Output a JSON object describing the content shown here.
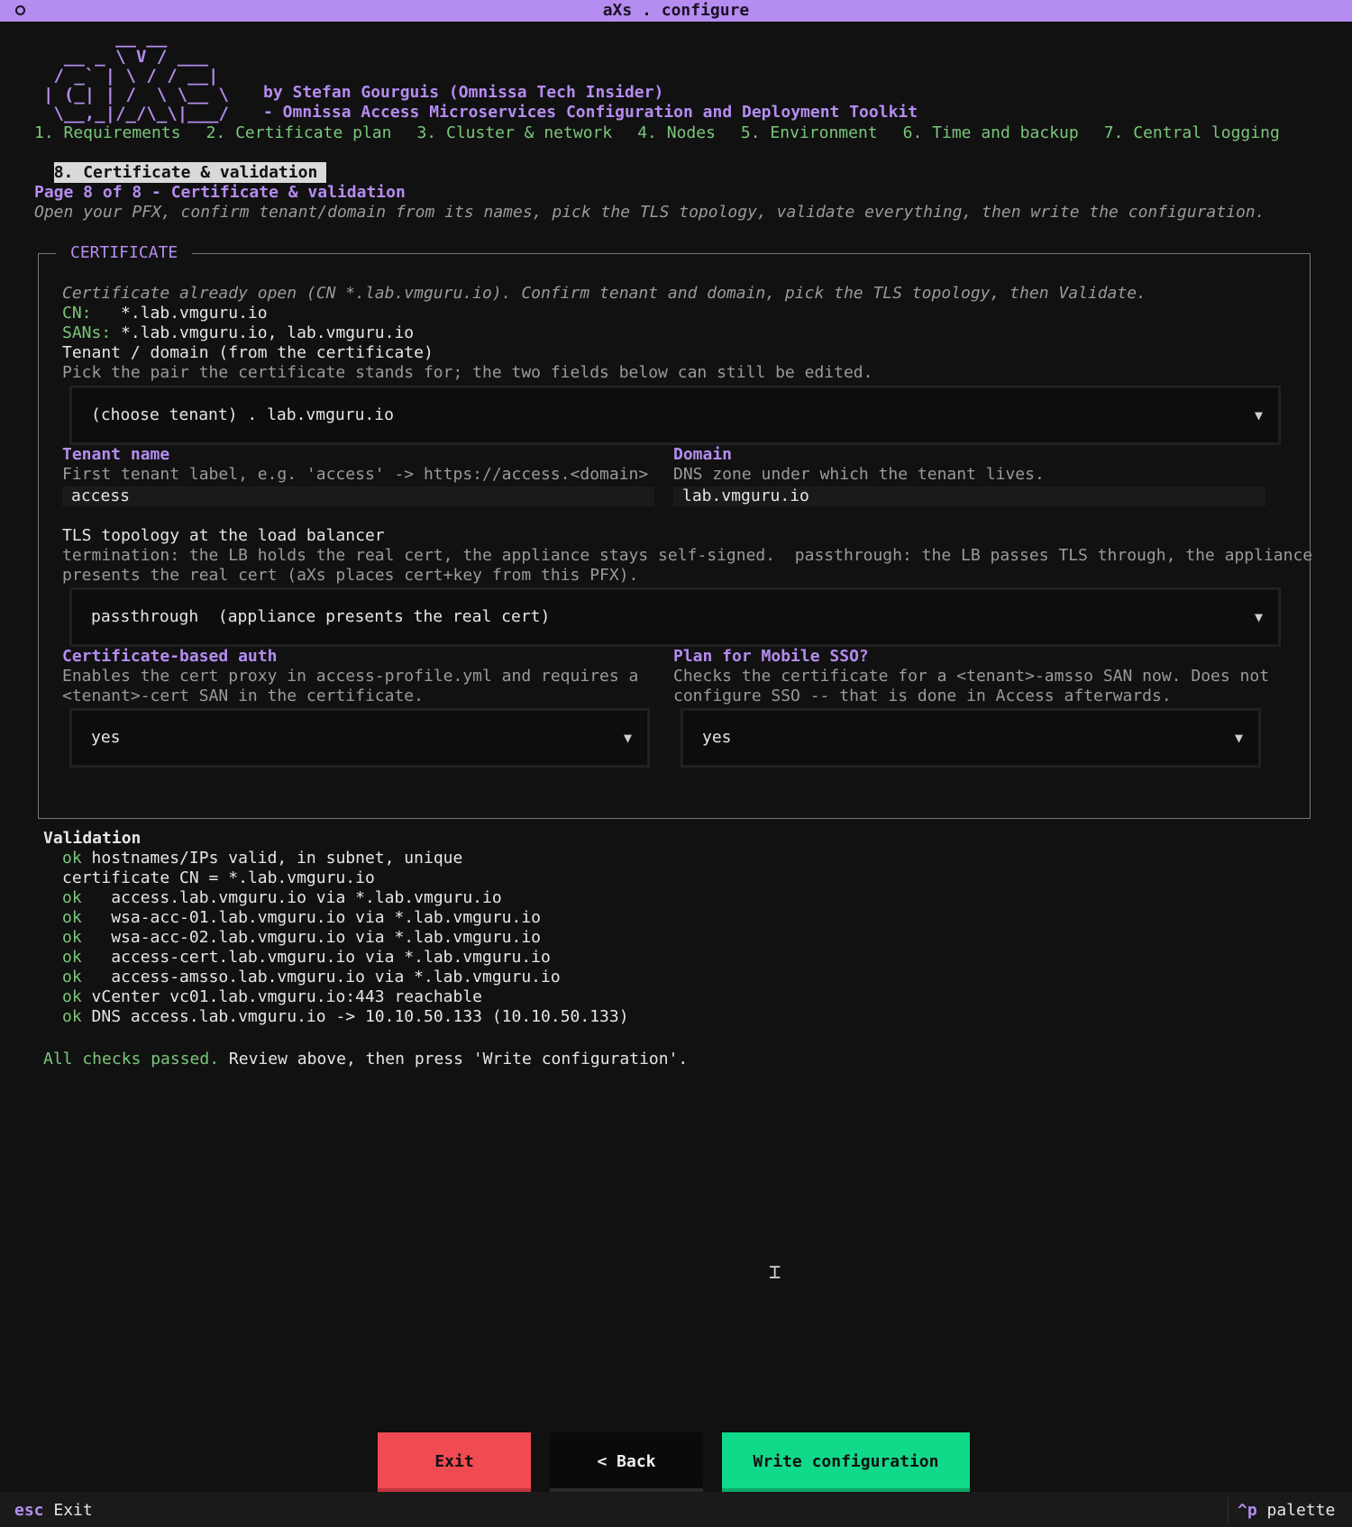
{
  "window": {
    "title": "aXs . configure"
  },
  "header": {
    "logo_ascii": "       __ __\n  __ _ \\ V / ___\n / _` | \\ / / __|\n| (_| | /  \\ \\__ \\\n \\__,_|/_/\\_\\|___/",
    "byline": "by Stefan Gourguis (Omnissa Tech Insider)",
    "subtitle": "- Omnissa Access Microservices Configuration and Deployment Toolkit"
  },
  "tabs": [
    {
      "label": "1. Requirements"
    },
    {
      "label": "2. Certificate plan"
    },
    {
      "label": "3. Cluster & network"
    },
    {
      "label": "4. Nodes"
    },
    {
      "label": "5. Environment"
    },
    {
      "label": "6. Time and backup"
    },
    {
      "label": "7. Central logging"
    },
    {
      "label": "8. Certificate & validation",
      "active": true
    }
  ],
  "page": {
    "heading": "Page 8 of 8 - Certificate & validation",
    "description": "Open your PFX, confirm tenant/domain from its names, pick the TLS topology, validate everything, then write the configuration."
  },
  "certificate": {
    "section_title": "CERTIFICATE",
    "status": "Certificate already open (CN *.lab.vmguru.io). Confirm tenant and domain, pick the TLS topology, then Validate.",
    "cn_label": "CN:",
    "cn_value": "*.lab.vmguru.io",
    "sans_label": "SANs:",
    "sans_value": "*.lab.vmguru.io, lab.vmguru.io",
    "pair_label": "Tenant / domain (from the certificate)",
    "pair_help": "Pick the pair the certificate stands for; the two fields below can still be edited.",
    "pair_select": "(choose tenant) . lab.vmguru.io",
    "tenant_label": "Tenant name",
    "tenant_help": "First tenant label, e.g. 'access' -> https://access.<domain>",
    "tenant_value": "access",
    "domain_label": "Domain",
    "domain_help": "DNS zone under which the tenant lives.",
    "domain_value": "lab.vmguru.io",
    "tls_label": "TLS topology at the load balancer",
    "tls_help_1": "termination: the LB holds the real cert, the appliance stays self-signed.  passthrough: the LB passes TLS through, the appliance",
    "tls_help_2": "presents the real cert (aXs places cert+key from this PFX).",
    "tls_select": "passthrough  (appliance presents the real cert)",
    "cba_label": "Certificate-based auth",
    "cba_help_1": "Enables the cert proxy in access-profile.yml and requires a",
    "cba_help_2": "<tenant>-cert SAN in the certificate.",
    "cba_select": "yes",
    "sso_label": "Plan for Mobile SSO?",
    "sso_help_1": "Checks the certificate for a <tenant>-amsso SAN now. Does not",
    "sso_help_2": "configure SSO -- that is done in Access afterwards.",
    "sso_select": "yes"
  },
  "validation": {
    "heading": "Validation",
    "lines": [
      {
        "status": "ok",
        "text": " hostnames/IPs valid, in subnet, unique"
      },
      {
        "status": "",
        "text": "certificate CN = *.lab.vmguru.io"
      },
      {
        "status": "ok",
        "text": "   access.lab.vmguru.io via *.lab.vmguru.io"
      },
      {
        "status": "ok",
        "text": "   wsa-acc-01.lab.vmguru.io via *.lab.vmguru.io"
      },
      {
        "status": "ok",
        "text": "   wsa-acc-02.lab.vmguru.io via *.lab.vmguru.io"
      },
      {
        "status": "ok",
        "text": "   access-cert.lab.vmguru.io via *.lab.vmguru.io"
      },
      {
        "status": "ok",
        "text": "   access-amsso.lab.vmguru.io via *.lab.vmguru.io"
      },
      {
        "status": "ok",
        "text": " vCenter vc01.lab.vmguru.io:443 reachable"
      },
      {
        "status": "ok",
        "text": " DNS access.lab.vmguru.io -> 10.10.50.133 (10.10.50.133)"
      }
    ],
    "summary_ok": "All checks passed.",
    "summary_rest": " Review above, then press 'Write configuration'."
  },
  "buttons": {
    "exit": "Exit",
    "back": "< Back",
    "write": "Write configuration"
  },
  "footer": {
    "esc_key": "esc",
    "esc_label": " Exit",
    "palette_key": "^p",
    "palette_label": " palette"
  }
}
